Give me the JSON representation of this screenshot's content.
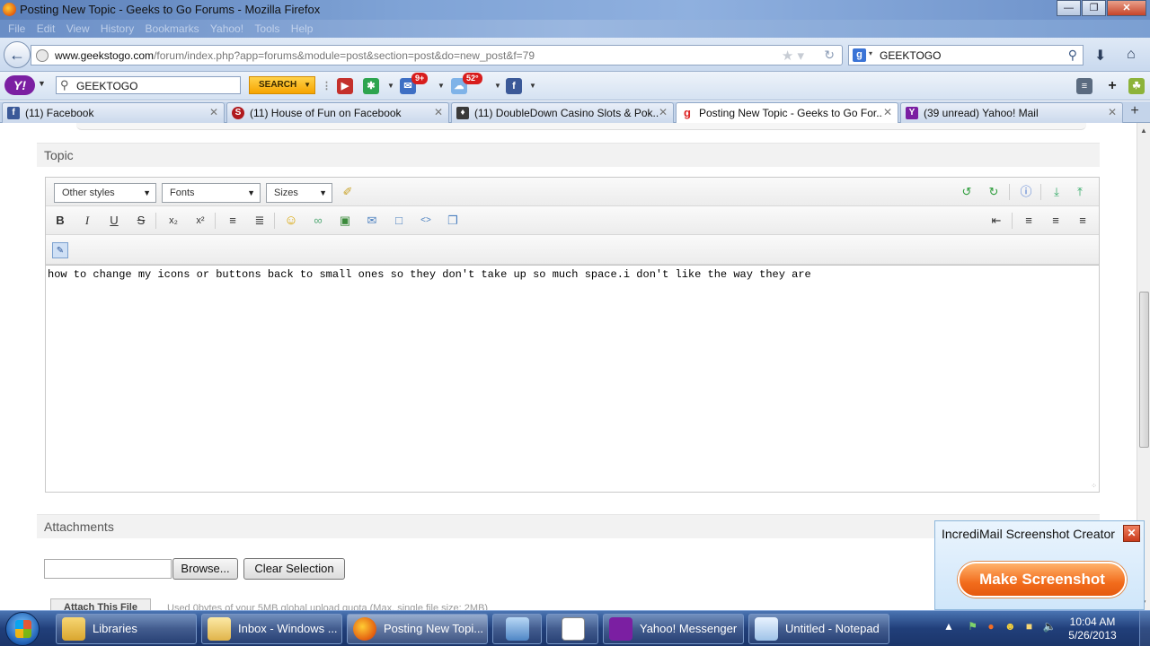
{
  "window": {
    "title": "Posting New Topic - Geeks to Go Forums - Mozilla Firefox"
  },
  "menu": [
    "File",
    "Edit",
    "View",
    "History",
    "Bookmarks",
    "Yahoo!",
    "Tools",
    "Help"
  ],
  "nav": {
    "url_domain": "www.geekstogo.com",
    "url_path": "/forum/index.php?app=forums&module=post&section=post&do=new_post&f=79",
    "search_value": "GEEKTOGO",
    "search_engine": "g"
  },
  "yahoo_toolbar": {
    "logo": "Y!",
    "search_value": "GEEKTOGO",
    "search_button": "SEARCH",
    "mail_badge": "9+",
    "weather_badge": "52°"
  },
  "tabs": [
    {
      "label": "(11) Facebook",
      "active": false
    },
    {
      "label": "(11) House of Fun on Facebook",
      "active": false
    },
    {
      "label": "(11) DoubleDown Casino Slots & Pok...",
      "active": false
    },
    {
      "label": "Posting New Topic - Geeks to Go For...",
      "active": true
    },
    {
      "label": "(39 unread) Yahoo! Mail",
      "active": false
    }
  ],
  "page": {
    "topic_heading": "Topic",
    "editor": {
      "styles_select": "Other styles",
      "fonts_select": "Fonts",
      "sizes_select": "Sizes",
      "body_text": "how to change my icons or buttons back to small ones so they don't take up so much space.i don't like the way they are"
    },
    "attachments_heading": "Attachments",
    "browse_button": "Browse...",
    "clear_button": "Clear Selection",
    "attach_button": "Attach This File",
    "quota_text": "Used 0bytes of your 5MB global upload quota (Max. single file size: 2MB)"
  },
  "popup": {
    "title": "IncrediMail Screenshot Creator",
    "button": "Make Screenshot"
  },
  "taskbar": {
    "items": [
      {
        "label": "Libraries"
      },
      {
        "label": "Inbox - Windows ..."
      },
      {
        "label": "Posting New Topi..."
      },
      {
        "label": ""
      },
      {
        "label": ""
      },
      {
        "label": "Yahoo! Messenger"
      },
      {
        "label": "Untitled - Notepad"
      }
    ],
    "time": "10:04 AM",
    "date": "5/26/2013"
  },
  "colors": {
    "accent": "#f26c1c",
    "titlebar": "#7fa3d6",
    "taskbar": "#213f7a"
  }
}
